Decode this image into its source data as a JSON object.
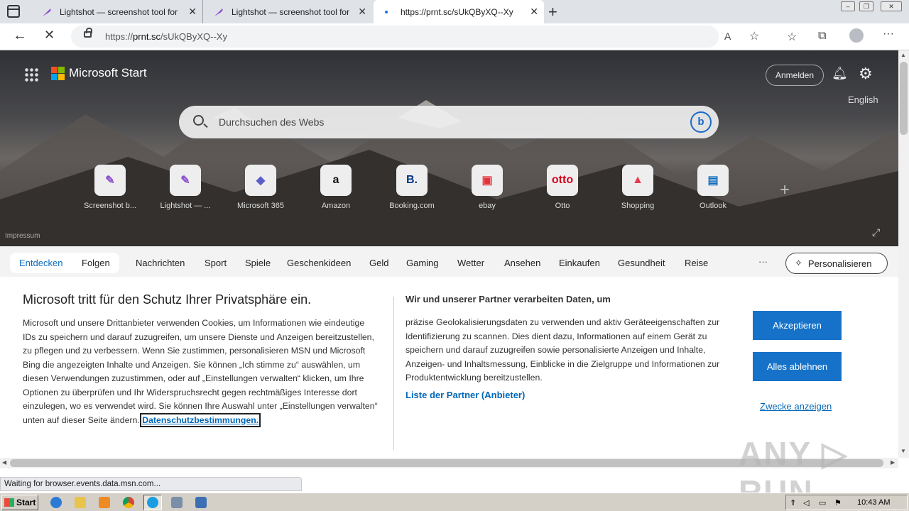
{
  "tabs": [
    {
      "title": "Lightshot — screenshot tool for M",
      "close": "✕"
    },
    {
      "title": "Lightshot — screenshot tool for M",
      "close": "✕"
    },
    {
      "title": "https://prnt.sc/sUkQByXQ--Xy",
      "close": "✕"
    }
  ],
  "new_tab": "+",
  "address": {
    "url_prefix": "https://",
    "url_host": "prnt.sc",
    "url_path": "/sUkQByXQ--Xy"
  },
  "header": {
    "brand": "Microsoft Start",
    "signin": "Anmelden",
    "language": "English"
  },
  "search": {
    "placeholder": "Durchsuchen des Webs",
    "bing": "b"
  },
  "tiles": [
    {
      "label": "Screenshot b...",
      "glyph": "✎",
      "color": "#8a4fcf"
    },
    {
      "label": "Lightshot — ...",
      "glyph": "✎",
      "color": "#8a4fcf"
    },
    {
      "label": "Microsoft 365",
      "glyph": "◆",
      "color": "#5b5fc7"
    },
    {
      "label": "Amazon",
      "glyph": "a",
      "color": "#111111"
    },
    {
      "label": "Booking.com",
      "glyph": "B.",
      "color": "#003580"
    },
    {
      "label": "ebay",
      "glyph": "▣",
      "color": "#e53238"
    },
    {
      "label": "Otto",
      "glyph": "otto",
      "color": "#d8001a"
    },
    {
      "label": "Shopping",
      "glyph": "▲",
      "color": "#e8384f"
    },
    {
      "label": "Outlook",
      "glyph": "▤",
      "color": "#0f6cbd"
    }
  ],
  "add_tile": "+",
  "impressum": "Impressum",
  "categories": {
    "active": "Entdecken",
    "follow": "Folgen",
    "items": [
      "Nachrichten",
      "Sport",
      "Spiele",
      "Geschenkideen",
      "Geld",
      "Gaming",
      "Wetter",
      "Ansehen",
      "Einkaufen",
      "Gesundheit",
      "Reise"
    ],
    "more": "···",
    "personalize": "Personalisieren"
  },
  "consent": {
    "title": "Microsoft tritt für den Schutz Ihrer Privatsphäre ein.",
    "body": "Microsoft und unsere Drittanbieter verwenden Cookies, um Informationen wie eindeutige IDs zu speichern und darauf zuzugreifen, um unsere Dienste und Anzeigen bereitzustellen, zu pflegen und zu verbessern. Wenn Sie zustimmen, personalisieren MSN und Microsoft Bing die angezeigten Inhalte und Anzeigen. Sie können „Ich stimme zu“ auswählen, um diesen Verwendungen zuzustimmen, oder auf „Einstellungen verwalten“ klicken, um Ihre Optionen zu überprüfen und Ihr Widerspruchsrecht gegen rechtmäßiges Interesse dort einzulegen, wo es verwendet wird. Sie können Ihre Auswahl unter „Einstellungen verwalten“ unten auf dieser Seite ändern.",
    "privacy_link": "Datenschutzbestimmungen.",
    "partner_title": "Wir und unserer Partner verarbeiten Daten, um",
    "partner_body": "präzise Geolokalisierungsdaten zu verwenden und aktiv Geräteeigenschaften zur Identifizierung zu scannen. Dies dient dazu, Informationen auf einem Gerät zu speichern und darauf zuzugreifen sowie personalisierte Anzeigen und Inhalte, Anzeigen- und Inhaltsmessung, Einblicke in die Zielgruppe und Informationen zur Produktentwicklung bereitzustellen.",
    "partner_link": "Liste der Partner (Anbieter)",
    "accept": "Akzeptieren",
    "reject": "Alles ablehnen",
    "purposes": "Zwecke anzeigen"
  },
  "watermark": "ANY ▷ RUN",
  "status_text": "Waiting for browser.events.data.msn.com...",
  "taskbar": {
    "start": "Start",
    "clock": "10:43 AM"
  },
  "colors": {
    "accent": "#1672c9",
    "link": "#0067b8"
  }
}
